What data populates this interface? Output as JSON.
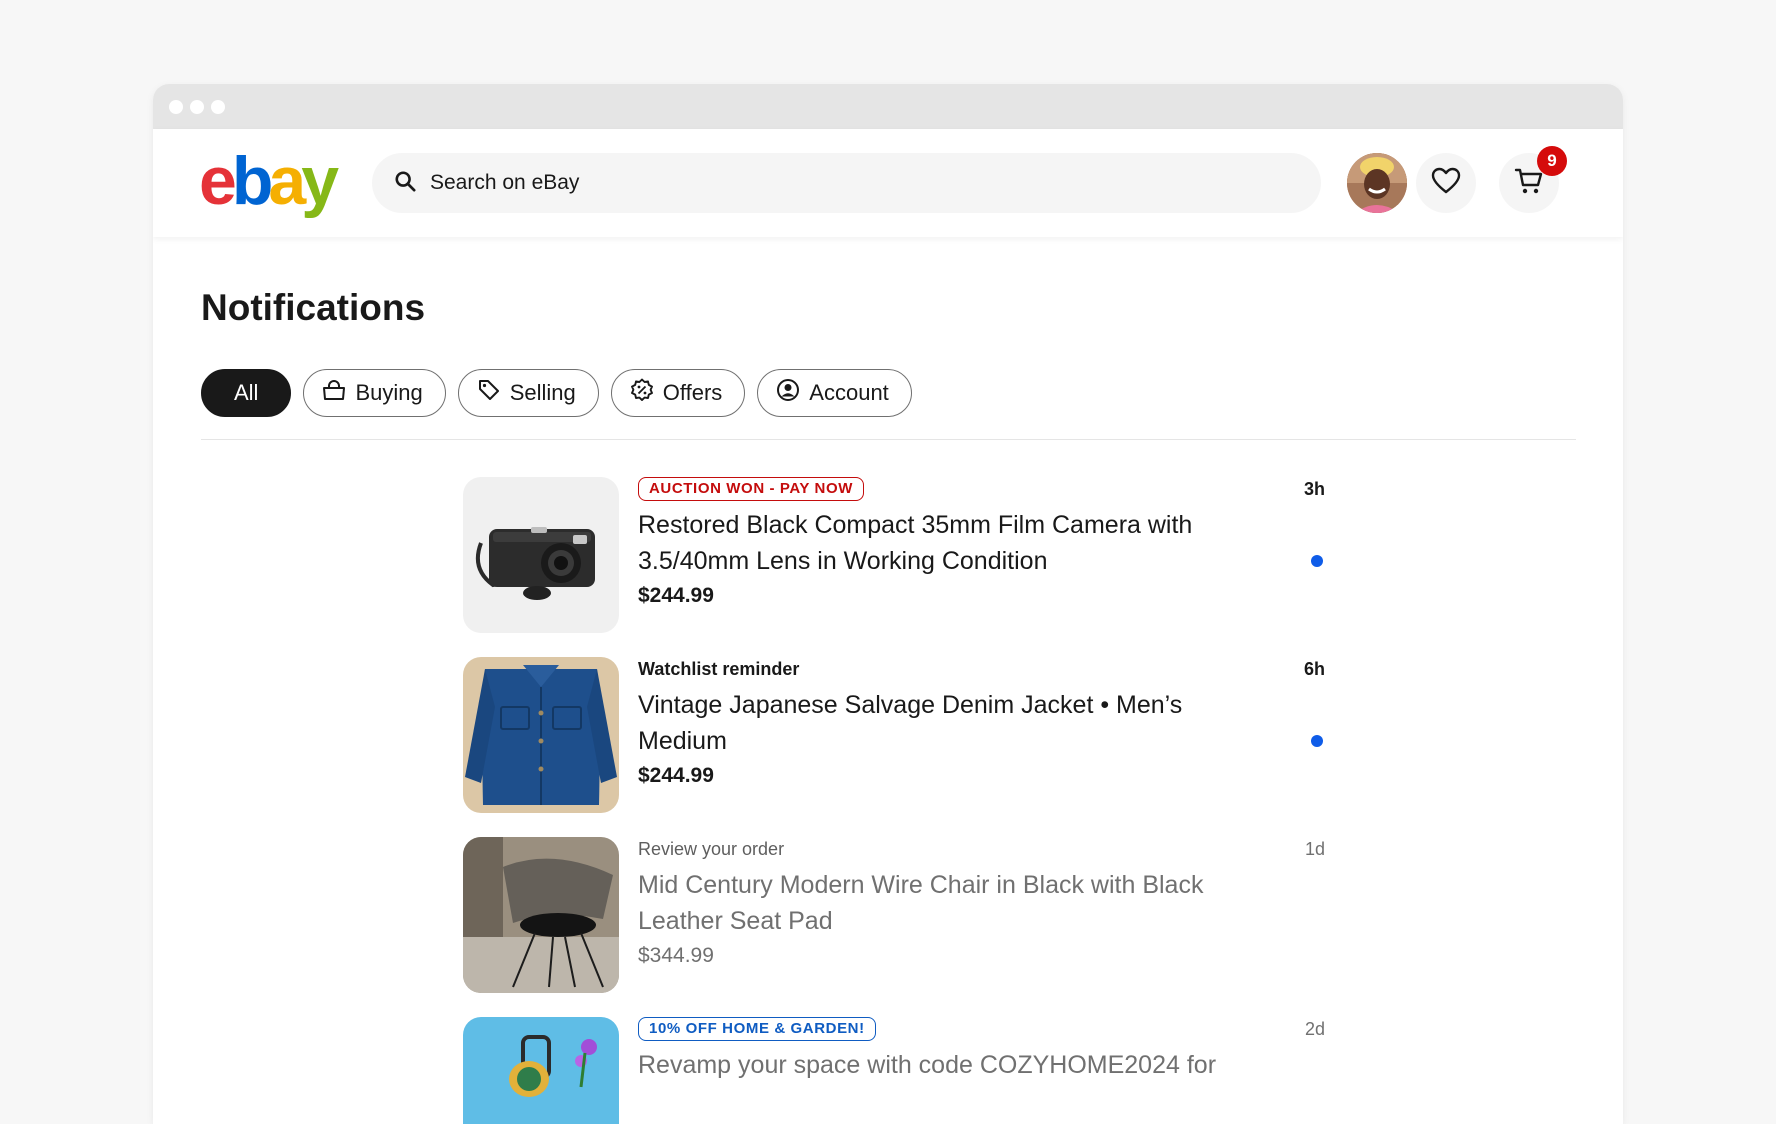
{
  "header": {
    "logo_letters": [
      "e",
      "b",
      "a",
      "y"
    ],
    "search_placeholder": "Search on eBay",
    "cart_count": "9"
  },
  "page": {
    "title": "Notifications"
  },
  "filters": [
    {
      "label": "All",
      "icon": "none",
      "active": true
    },
    {
      "label": "Buying",
      "icon": "shopping-bag-icon",
      "active": false
    },
    {
      "label": "Selling",
      "icon": "tag-icon",
      "active": false
    },
    {
      "label": "Offers",
      "icon": "offer-badge-icon",
      "active": false
    },
    {
      "label": "Account",
      "icon": "user-circle-icon",
      "active": false
    }
  ],
  "notifications": [
    {
      "kicker": "AUCTION WON - PAY NOW",
      "kicker_style": "badge-red",
      "title_line1": "Restored Black Compact 35mm Film Camera with",
      "title_line2": "3.5/40mm Lens in Working Condition",
      "price": "$244.99",
      "time": "3h",
      "unread": true
    },
    {
      "kicker": "Watchlist reminder",
      "kicker_style": "bold",
      "title_line1": "Vintage Japanese Salvage Denim Jacket • Men’s",
      "title_line2": "Medium",
      "price": "$244.99",
      "time": "6h",
      "unread": true
    },
    {
      "kicker": "Review your order",
      "kicker_style": "muted",
      "title_line1": "Mid Century Modern Wire Chair in Black  with Black",
      "title_line2": "Leather Seat Pad",
      "price": "$344.99",
      "time": "1d",
      "unread": false
    },
    {
      "kicker": "10% OFF HOME & GARDEN!",
      "kicker_style": "badge-blue",
      "title_line1": "Revamp your space with code COZYHOME2024 for",
      "title_line2": "",
      "price": "",
      "time": "2d",
      "unread": false
    }
  ],
  "colors": {
    "logo_e": "#e53238",
    "logo_b": "#0064d2",
    "logo_a": "#f5af02",
    "logo_y": "#86b817",
    "cart_badge": "#d50b0b",
    "unread_dot": "#0f5ce8",
    "badge_red": "#c40c0c",
    "badge_blue": "#0f5cc2"
  }
}
